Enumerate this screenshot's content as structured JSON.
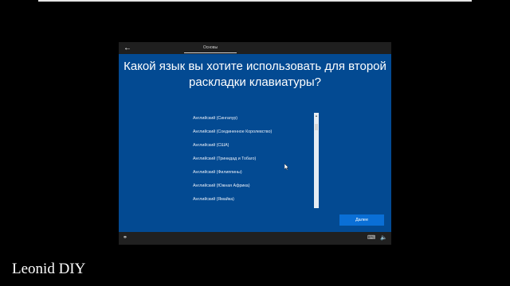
{
  "header": {
    "back_icon": "arrow-left-icon",
    "tab_label": "Основы"
  },
  "main": {
    "title": "Какой язык вы хотите использовать для второй раскладки клавиатуры?",
    "languages": [
      "Английский (Сингапур)",
      "Английский (Соединенное Королевство)",
      "Английский (США)",
      "Английский (Тринидад и Тобаго)",
      "Английский (Филиппины)",
      "Английский (Южная Африка)",
      "Английский (Ямайка)"
    ],
    "next_label": "Далее"
  },
  "footer": {
    "accessibility_icon": "accessibility-icon",
    "keyboard_icon": "keyboard-icon",
    "volume_icon": "volume-icon"
  },
  "watermark": "Leonid DIY",
  "colors": {
    "background": "#000000",
    "panel_blue": "#034a92",
    "button_blue": "#0a6fd6",
    "chrome_dark": "#202020"
  }
}
